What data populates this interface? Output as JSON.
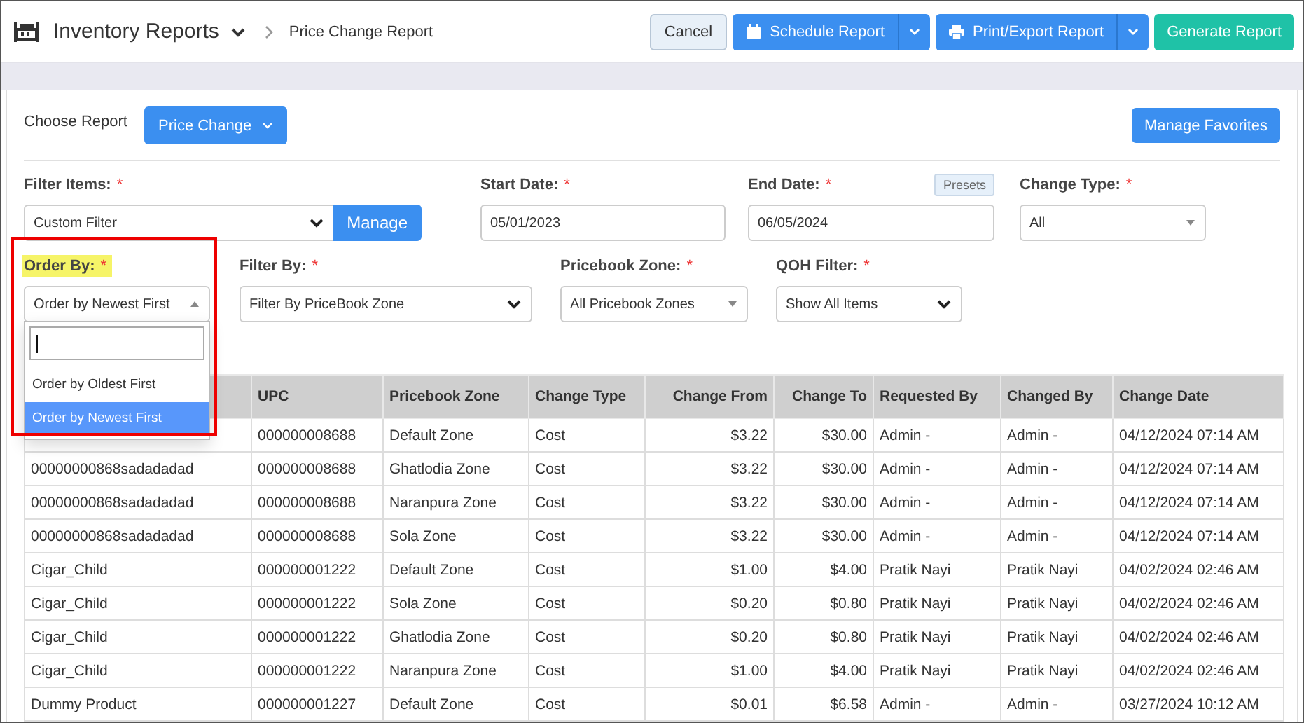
{
  "header": {
    "title": "Inventory Reports",
    "breadcrumb": "Price Change Report",
    "buttons": [
      {
        "label": "Cancel",
        "kind": "plain"
      },
      {
        "label": "Schedule Report",
        "kind": "split"
      },
      {
        "label": "Print/Export Report",
        "kind": "split"
      },
      {
        "label": "Generate Report",
        "kind": "primary"
      }
    ]
  },
  "choose_report": {
    "label": "Choose Report",
    "value": "Price Change",
    "favorites_button": "Manage Favorites"
  },
  "filter_rows": [
    [
      {
        "kind": "select-button",
        "label": "Filter Items:",
        "required_mark": "*",
        "value": "Custom Filter",
        "button": "Manage"
      },
      {
        "kind": "date",
        "label": "Start Date:",
        "required_mark": "*",
        "value": "05/01/2023"
      },
      {
        "kind": "date",
        "label": "End Date:",
        "required_mark": "*",
        "value": "06/05/2024",
        "presets": "Presets"
      },
      {
        "kind": "select2",
        "label": "Change Type:",
        "required_mark": "*",
        "value": "All"
      }
    ],
    [
      {
        "kind": "select2",
        "label": "Order By:",
        "required_mark": "*",
        "value": "Order by Newest First",
        "open": true,
        "highlighted": true,
        "options": [
          {
            "label": "Order by Oldest First",
            "selected": false
          },
          {
            "label": "Order by Newest First",
            "selected": true
          }
        ]
      },
      {
        "kind": "select",
        "label": "Filter By:",
        "required_mark": "*",
        "value": "Filter By PriceBook Zone"
      },
      {
        "kind": "select2",
        "label": "Pricebook Zone:",
        "required_mark": "*",
        "value": "All Pricebook Zones"
      },
      {
        "kind": "select",
        "label": "QOH Filter:",
        "required_mark": "*",
        "value": "Show All Items"
      }
    ]
  ],
  "table": {
    "columns": [
      null,
      "UPC",
      "Pricebook Zone",
      "Change Type",
      "Change From",
      "Change To",
      "Requested By",
      "Changed By",
      "Change Date"
    ],
    "rows": [
      [
        null,
        "000000008688",
        "Default Zone",
        "Cost",
        "$3.22",
        "$30.00",
        "Admin -",
        "Admin -",
        "04/12/2024 07:14 AM"
      ],
      [
        "00000000868sadadadad",
        "000000008688",
        "Ghatlodia Zone",
        "Cost",
        "$3.22",
        "$30.00",
        "Admin -",
        "Admin -",
        "04/12/2024 07:14 AM"
      ],
      [
        "00000000868sadadadad",
        "000000008688",
        "Naranpura Zone",
        "Cost",
        "$3.22",
        "$30.00",
        "Admin -",
        "Admin -",
        "04/12/2024 07:14 AM"
      ],
      [
        "00000000868sadadadad",
        "000000008688",
        "Sola Zone",
        "Cost",
        "$3.22",
        "$30.00",
        "Admin -",
        "Admin -",
        "04/12/2024 07:14 AM"
      ],
      [
        "Cigar_Child",
        "000000001222",
        "Default Zone",
        "Cost",
        "$1.00",
        "$4.00",
        "Pratik Nayi",
        "Pratik Nayi",
        "04/02/2024 02:46 AM"
      ],
      [
        "Cigar_Child",
        "000000001222",
        "Sola Zone",
        "Cost",
        "$0.20",
        "$0.80",
        "Pratik Nayi",
        "Pratik Nayi",
        "04/02/2024 02:46 AM"
      ],
      [
        "Cigar_Child",
        "000000001222",
        "Ghatlodia Zone",
        "Cost",
        "$0.20",
        "$0.80",
        "Pratik Nayi",
        "Pratik Nayi",
        "04/02/2024 02:46 AM"
      ],
      [
        "Cigar_Child",
        "000000001222",
        "Naranpura Zone",
        "Cost",
        "$1.00",
        "$4.00",
        "Pratik Nayi",
        "Pratik Nayi",
        "04/02/2024 02:46 AM"
      ],
      [
        "Dummy Product",
        "000000001227",
        "Default Zone",
        "Cost",
        "$0.01",
        "$6.58",
        "Admin -",
        "Admin -",
        "03/27/2024 10:12 AM"
      ]
    ]
  }
}
